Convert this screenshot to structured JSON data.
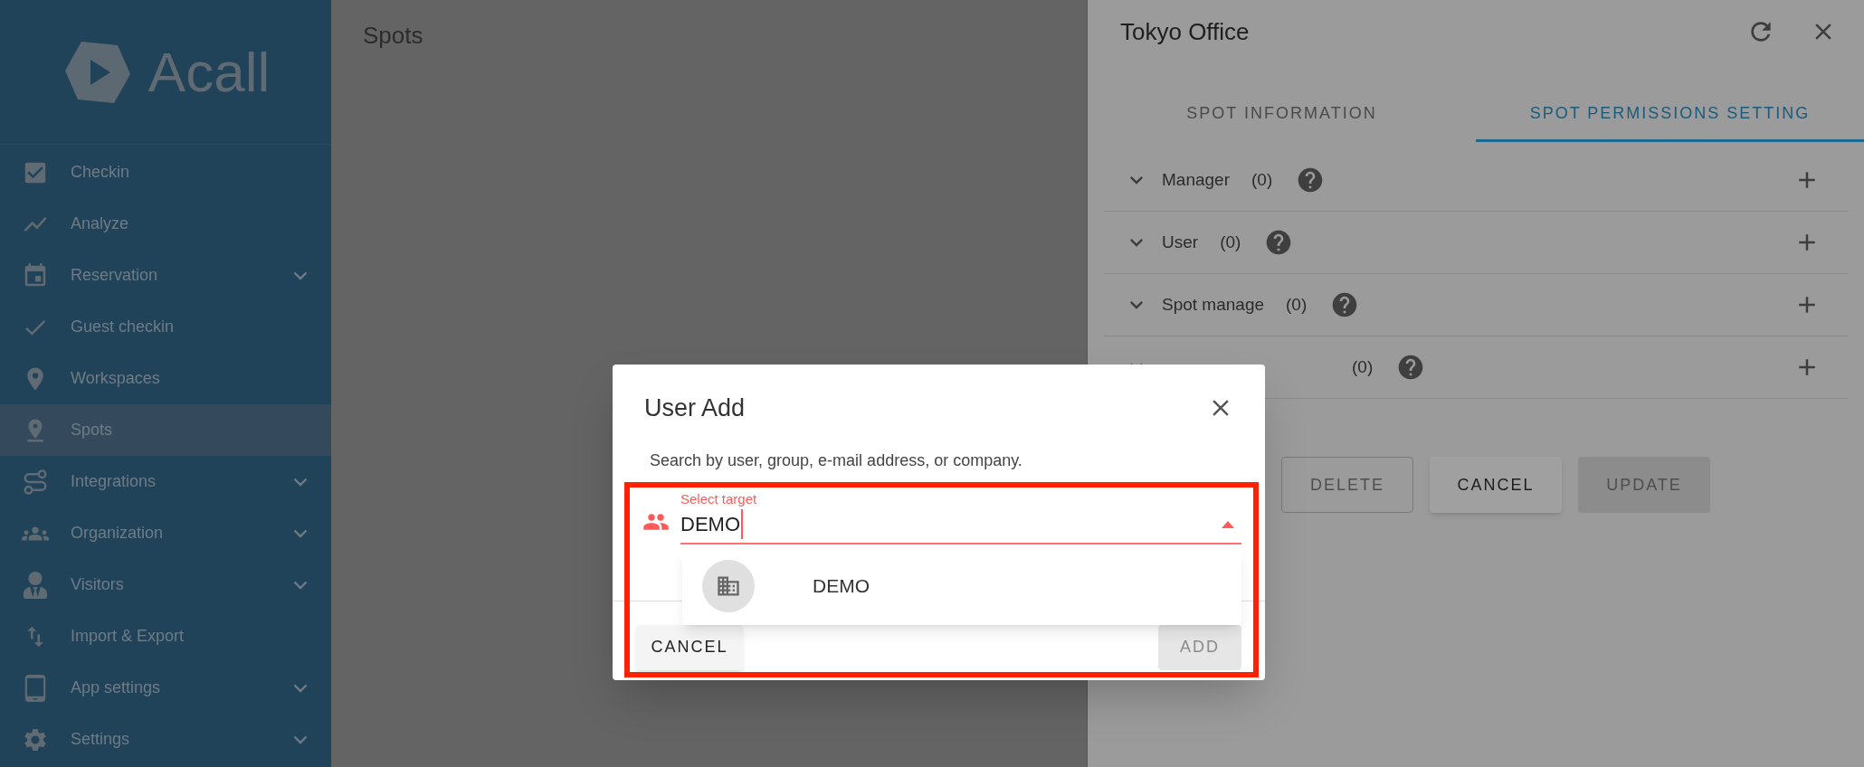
{
  "sidebar": {
    "logo": "Acall",
    "items": [
      {
        "label": "Checkin",
        "selected": false,
        "has_submenu": false
      },
      {
        "label": "Analyze",
        "selected": false,
        "has_submenu": false
      },
      {
        "label": "Reservation",
        "selected": false,
        "has_submenu": true
      },
      {
        "label": "Guest checkin",
        "selected": false,
        "has_submenu": false
      },
      {
        "label": "Workspaces",
        "selected": false,
        "has_submenu": false
      },
      {
        "label": "Spots",
        "selected": true,
        "has_submenu": false
      },
      {
        "label": "Integrations",
        "selected": false,
        "has_submenu": true
      },
      {
        "label": "Organization",
        "selected": false,
        "has_submenu": true
      },
      {
        "label": "Visitors",
        "selected": false,
        "has_submenu": true
      },
      {
        "label": "Import & Export",
        "selected": false,
        "has_submenu": false
      },
      {
        "label": "App settings",
        "selected": false,
        "has_submenu": true
      },
      {
        "label": "Settings",
        "selected": false,
        "has_submenu": true
      }
    ]
  },
  "main": {
    "title": "Spots"
  },
  "panel": {
    "title": "Tokyo Office",
    "tabs": [
      {
        "label": "SPOT INFORMATION",
        "selected": false
      },
      {
        "label": "SPOT PERMISSIONS SETTING",
        "selected": true
      }
    ],
    "permissions": [
      {
        "label": "Manager",
        "count": "(0)"
      },
      {
        "label": "User",
        "count": "(0)"
      },
      {
        "label": "Spot manage",
        "count": "(0)"
      },
      {
        "count": "(0)"
      }
    ],
    "buttons": [
      {
        "label": "DELETE",
        "kind": "outlined",
        "disabled": true
      },
      {
        "label": "CANCEL",
        "kind": "raised",
        "disabled": false
      },
      {
        "label": "UPDATE",
        "kind": "raised",
        "disabled": true
      }
    ]
  },
  "dialog": {
    "title": "User Add",
    "hint": "Search by user, group, e-mail address, or company.",
    "field": {
      "label": "Select target",
      "value": "DEMO",
      "expanded": true
    },
    "options": [
      {
        "label": "DEMO",
        "selected": false
      }
    ],
    "buttons": [
      {
        "label": "CANCEL",
        "disabled": false
      },
      {
        "label": "ADD",
        "disabled": true
      }
    ]
  }
}
